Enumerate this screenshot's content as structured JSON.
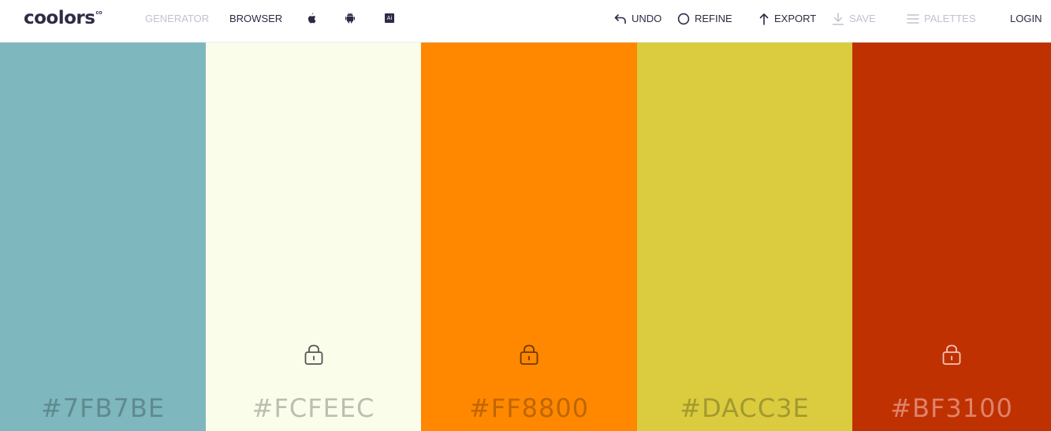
{
  "app": {
    "logo_text": "coolors",
    "logo_suffix": "co"
  },
  "nav_left": {
    "generator": "GENERATOR",
    "browser": "BROWSER",
    "platform_icons": [
      "apple-icon",
      "android-icon",
      "adobe-illustrator-icon"
    ],
    "ai_label": "Ai"
  },
  "nav_right": {
    "undo": "UNDO",
    "refine": "REFINE",
    "export": "EXPORT",
    "save": "SAVE",
    "palettes": "PALETTES",
    "login": "LOGIN"
  },
  "palette": [
    {
      "hex": "#7FB7BE",
      "color": "#7FB7BE",
      "text_color": "#5f8a8f",
      "locked_icon_shown": false
    },
    {
      "hex": "#FCFEEC",
      "color": "#FAFDEA",
      "text_color": "#bdbeb1",
      "locked_icon_shown": true,
      "icon_color": "#555555"
    },
    {
      "hex": "#FF8800",
      "color": "#FF8800",
      "text_color": "#bf6600",
      "locked_icon_shown": true,
      "icon_color": "#6b3a00"
    },
    {
      "hex": "#DACC3E",
      "color": "#DACC3E",
      "text_color": "#a3992f",
      "locked_icon_shown": false
    },
    {
      "hex": "#BF3100",
      "color": "#BF3100",
      "text_color": "#e0826a",
      "locked_icon_shown": true,
      "icon_color": "#f5c6b8"
    }
  ]
}
